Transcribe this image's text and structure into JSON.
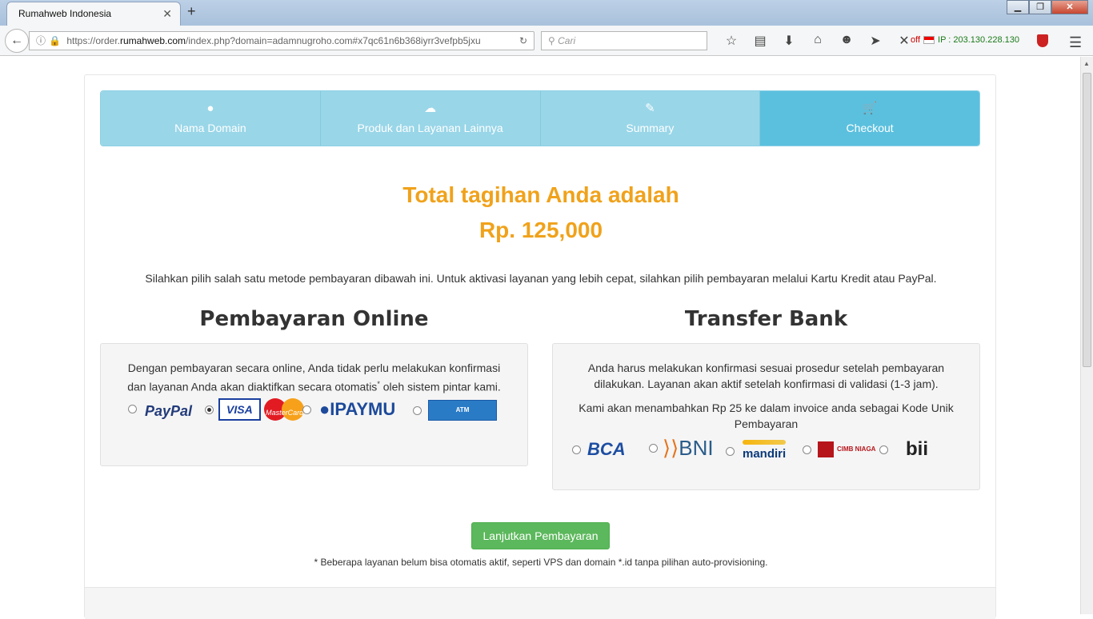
{
  "browser": {
    "tab_title": "Rumahweb Indonesia",
    "tab_close": "✕",
    "new_tab": "+",
    "win_min": "▁",
    "win_max": "❐",
    "win_close": "✕",
    "url_prefix": "https://order.",
    "url_domain": "rumahweb.com",
    "url_rest": "/index.php?domain=adamnugroho.com#x7qc61n6b368iyrr3vefpb5jxu",
    "search_placeholder": "Cari",
    "ip_off": "off",
    "ip_text": "IP : 203.130.228.130",
    "icons": [
      "back-icon",
      "info-icon",
      "lock-icon",
      "reload-icon",
      "search-icon",
      "star-icon",
      "clipboard-icon",
      "download-icon",
      "home-icon",
      "emoji-icon",
      "send-icon",
      "x-icon",
      "shield-icon",
      "menu-icon"
    ]
  },
  "steps": [
    {
      "label": "Nama Domain",
      "icon": "globe-icon",
      "glyph": "●"
    },
    {
      "label": "Produk dan Layanan Lainnya",
      "icon": "cloud-download-icon",
      "glyph": "☁"
    },
    {
      "label": "Summary",
      "icon": "edit-icon",
      "glyph": "✎"
    },
    {
      "label": "Checkout",
      "icon": "cart-icon",
      "glyph": "🛒"
    }
  ],
  "total": {
    "heading": "Total tagihan Anda adalah",
    "amount": "Rp. 125,000"
  },
  "info_text": "Silahkan pilih salah satu metode pembayaran dibawah ini. Untuk aktivasi layanan yang lebih cepat, silahkan pilih pembayaran melalui Kartu Kredit atau PayPal.",
  "online": {
    "title": "Pembayaran Online",
    "desc_1": "Dengan pembayaran secara online, Anda tidak perlu melakukan konfirmasi dan layanan Anda akan diaktifkan secara otomatis",
    "desc_sup": "*",
    "desc_2": " oleh sistem pintar kami.",
    "options": [
      {
        "name": "PayPal",
        "selected": false
      },
      {
        "name": "VISA",
        "name2": "MasterCard",
        "selected": true
      },
      {
        "name": "IPAYMU",
        "selected": false
      },
      {
        "name": "ATM",
        "selected": false
      }
    ]
  },
  "bank": {
    "title": "Transfer Bank",
    "desc_1": "Anda harus melakukan konfirmasi sesuai prosedur setelah pembayaran dilakukan. Layanan akan aktif setelah konfirmasi di validasi (1-3 jam).",
    "desc_2": "Kami akan menambahkan Rp 25 ke dalam invoice anda sebagai Kode Unik Pembayaran",
    "options": [
      {
        "name": "BCA"
      },
      {
        "name": "BNI"
      },
      {
        "name": "mandiri"
      },
      {
        "name": "CIMB NIAGA"
      },
      {
        "name": "bii"
      }
    ]
  },
  "actions": {
    "continue_label": "Lanjutkan Pembayaran",
    "note": "* Beberapa layanan belum bisa otomatis aktif, seperti VPS dan domain *.id tanpa pilihan auto-provisioning."
  },
  "colors": {
    "total": "#f0a21b",
    "step_inactive": "#99d6e8",
    "step_active": "#5bc0de",
    "button": "#5cb85c"
  }
}
